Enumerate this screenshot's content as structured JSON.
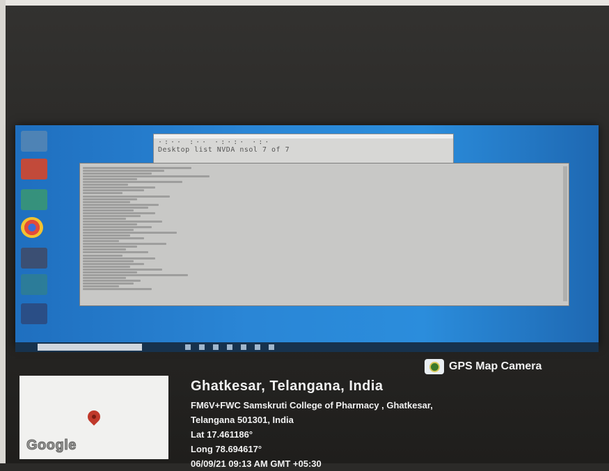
{
  "gps_overlay": {
    "brand": "GPS Map Camera",
    "location_title": "Ghatkesar, Telangana, India",
    "address_line1": "FM6V+FWC Samskruti College of Pharmacy , Ghatkesar,",
    "address_line2": "Telangana 501301, India",
    "lat": "Lat 17.461186°",
    "long": "Long 78.694617°",
    "datetime": "06/09/21 09:13 AM GMT +05:30",
    "map_logo": "Google"
  },
  "console_back": {
    "line1": "Desktop list NVDA nsol 7 of 7"
  },
  "colors": {
    "desktop_blue": "#2a86d6",
    "taskbar": "#17324d",
    "console_bg": "#c8c8c6",
    "pin_red": "#c0392b"
  },
  "icons": [
    "camera-icon",
    "map-pin-icon"
  ]
}
